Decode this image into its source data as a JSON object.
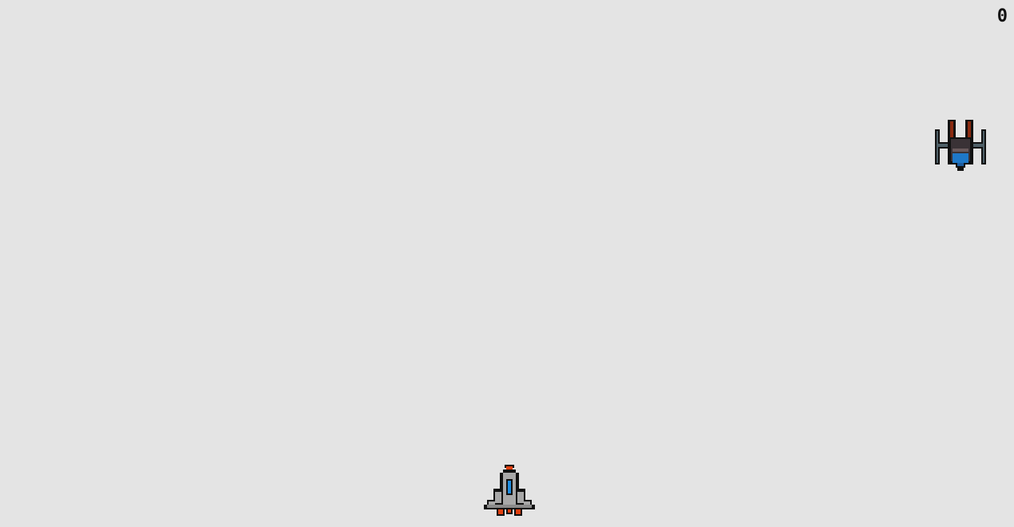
{
  "game": {
    "score": "0"
  },
  "colors": {
    "background": "#e4e4e4",
    "outline": "#111111",
    "enemy_body": "#2e2e33",
    "enemy_frame": "#4f6068",
    "enemy_cannon": "#8a2a10",
    "enemy_cockpit": "#1e78c8",
    "player_body": "#a8a8a8",
    "player_cockpit": "#1e8ce0",
    "player_thruster": "#e04010"
  },
  "sprites": {
    "enemy": "enemy-fighter-icon",
    "player": "player-rocket-icon"
  }
}
